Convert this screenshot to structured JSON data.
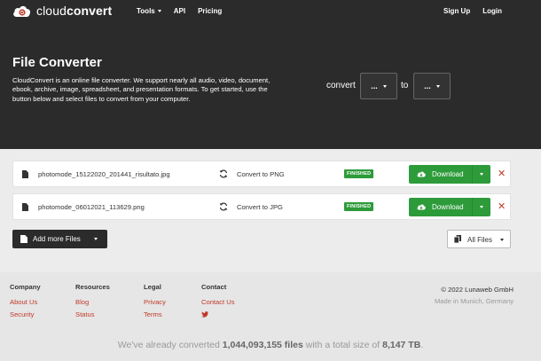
{
  "brand": {
    "name_light": "cloud",
    "name_bold": "convert"
  },
  "nav": {
    "left": [
      {
        "label": "Tools",
        "has_caret": true
      },
      {
        "label": "API"
      },
      {
        "label": "Pricing"
      }
    ],
    "right": [
      {
        "label": "Sign Up"
      },
      {
        "label": "Login"
      }
    ]
  },
  "hero": {
    "title": "File Converter",
    "description": "CloudConvert is an online file converter. We support nearly all audio, video, document, ebook, archive, image, spreadsheet, and presentation formats. To get started, use the button below and select files to convert from your computer.",
    "convert_label": "convert",
    "to_label": "to",
    "from_select": "...",
    "to_select": "..."
  },
  "files": [
    {
      "name": "photomode_15122020_201441_risultato.jpg",
      "convert": "Convert to PNG",
      "status": "FINISHED",
      "download": "Download"
    },
    {
      "name": "photomode_06012021_113629.png",
      "convert": "Convert to JPG",
      "status": "FINISHED",
      "download": "Download"
    }
  ],
  "actions": {
    "add_more": "Add more Files",
    "all_files": "All Files"
  },
  "footer": {
    "company": {
      "head": "Company",
      "links": [
        "About Us",
        "Security"
      ]
    },
    "resources": {
      "head": "Resources",
      "links": [
        "Blog",
        "Status"
      ]
    },
    "legal": {
      "head": "Legal",
      "links": [
        "Privacy",
        "Terms"
      ]
    },
    "contact": {
      "head": "Contact",
      "links": [
        "Contact Us"
      ]
    },
    "copyright": "© 2022 Lunaweb GmbH",
    "made_in": "Made in Munich, Germany",
    "stats_prefix": "We've already converted ",
    "stats_count": "1,044,093,155 files",
    "stats_middle": " with a total size of ",
    "stats_size": "8,147 TB",
    "stats_suffix": "."
  },
  "colors": {
    "accent": "#2d9b3a",
    "danger": "#c0392b",
    "hero_bg": "#2b2b2b"
  },
  "icons": [
    "cloudconvert-logo-icon",
    "document-icon",
    "refresh-icon",
    "cloud-download-icon",
    "close-icon",
    "files-icon",
    "twitter-icon",
    "chevron-down-icon"
  ]
}
